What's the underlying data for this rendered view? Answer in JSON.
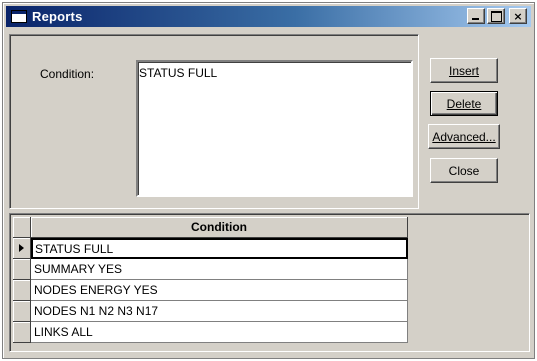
{
  "window": {
    "title": "Reports"
  },
  "title_buttons": {
    "minimize": "_",
    "maximize": "□",
    "close": "×"
  },
  "form": {
    "condition_label": "Condition:",
    "condition_value": "STATUS FULL"
  },
  "buttons": {
    "insert": "Insert",
    "delete": "Delete",
    "advanced": "Advanced...",
    "close": "Close"
  },
  "grid": {
    "column_header": "Condition",
    "rows": [
      "STATUS FULL",
      "SUMMARY YES",
      "NODES ENERGY YES",
      "NODES N1 N2 N3 N17",
      "LINKS ALL"
    ],
    "selected_index": 0
  },
  "colors": {
    "title_bar_start": "#0a246a",
    "title_bar_end": "#a6caf0",
    "face": "#d4d0c8"
  }
}
